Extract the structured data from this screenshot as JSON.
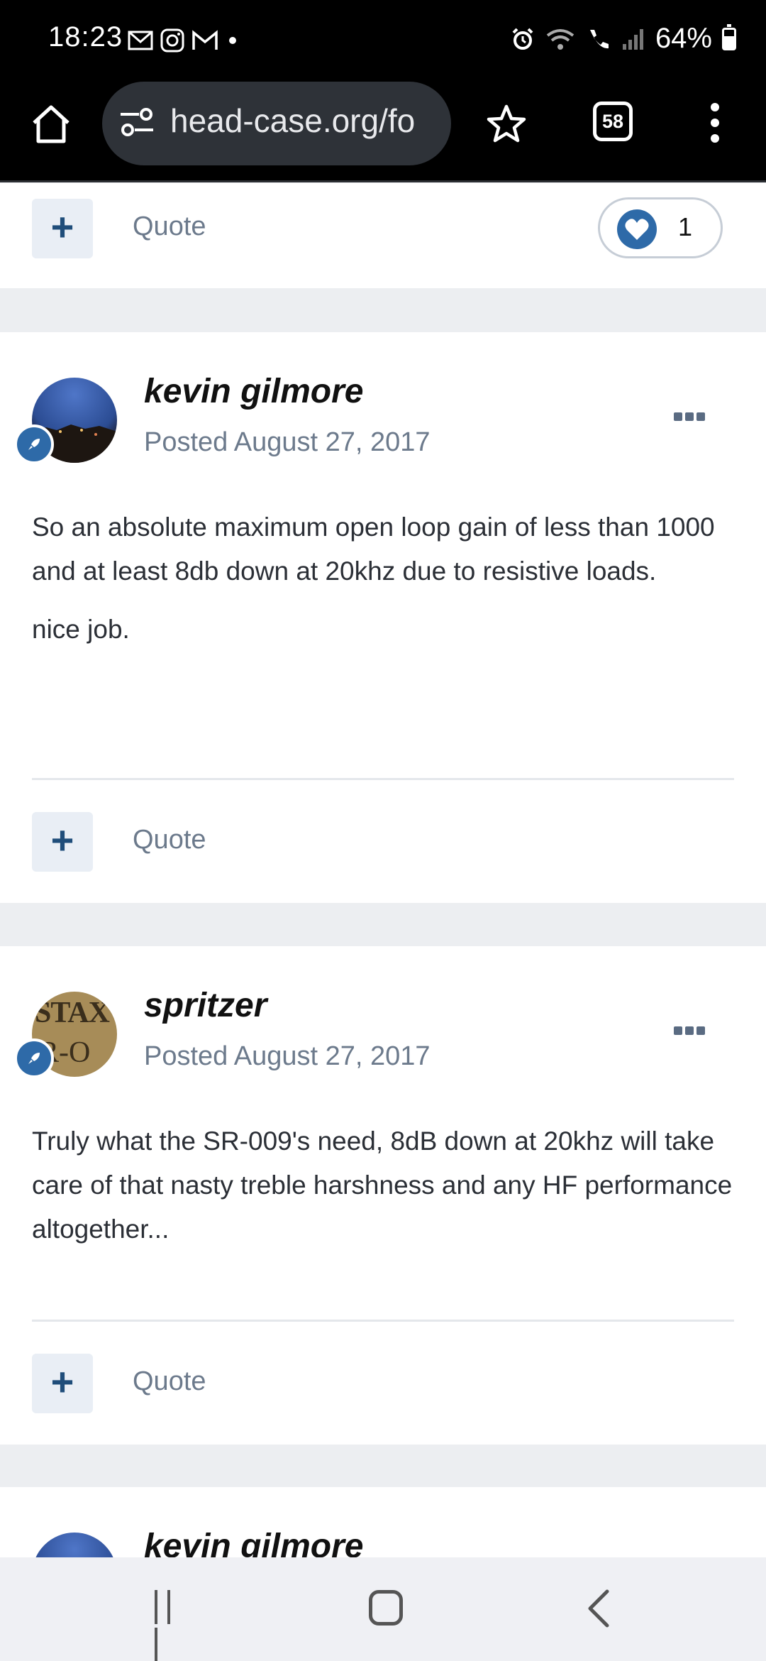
{
  "status_bar": {
    "time": "18:23",
    "battery_percent": "64%",
    "battery_level": 0.64
  },
  "browser": {
    "url": "head-case.org/fo",
    "tab_count": "58"
  },
  "top_card": {
    "quote_label": "Quote",
    "like_count": "1"
  },
  "posts": [
    {
      "author": "kevin gilmore",
      "date": "Posted August 27, 2017",
      "paragraphs": [
        "So an absolute maximum open loop gain of less than 1000 and at least 8db down at 20khz due to resistive loads.",
        "nice job."
      ],
      "quote_label": "Quote"
    },
    {
      "author": "spritzer",
      "avatar_text_1": "STAX",
      "avatar_text_2": "R-O",
      "date": "Posted August 27, 2017",
      "paragraphs": [
        "Truly what the SR-009's need, 8dB down at 20khz will take care of that nasty treble harshness and any HF performance altogether..."
      ],
      "quote_label": "Quote"
    },
    {
      "author": "kevin gilmore"
    }
  ],
  "colors": {
    "accent": "#2e6aa8",
    "muted_text": "#6c7a8c",
    "page_bg": "#eceef1"
  }
}
